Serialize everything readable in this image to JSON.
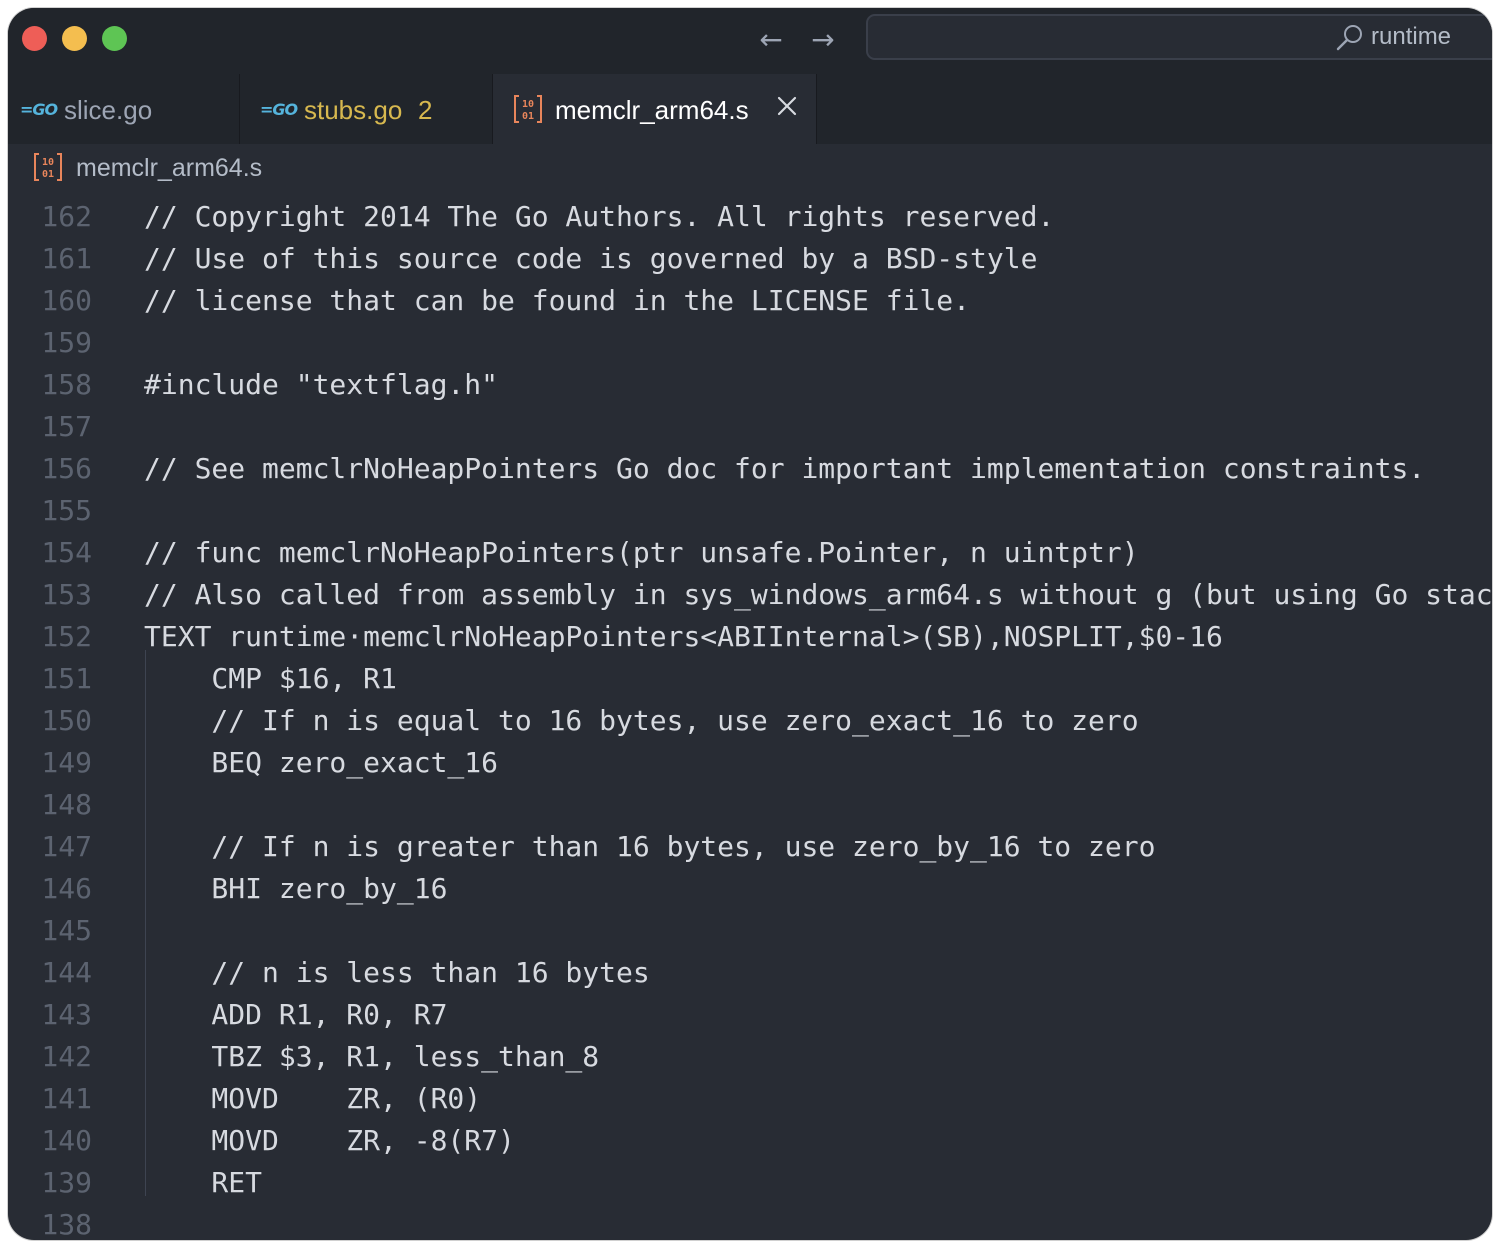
{
  "window": {
    "nav": {
      "back": "←",
      "forward": "→"
    },
    "search": {
      "text": "runtime",
      "icon": "search-icon"
    }
  },
  "tabs": [
    {
      "label": "slice.go",
      "icon": "go-file-icon",
      "icon_text": "=GO",
      "color": "#9da5b4"
    },
    {
      "label": "stubs.go",
      "icon": "go-file-icon",
      "icon_text": "=GO",
      "badge": "2",
      "color": "#d7b84f"
    },
    {
      "label": "memclr_arm64.s",
      "icon": "assembly-file-icon",
      "active": true,
      "close": "×",
      "color": "#ffffff"
    }
  ],
  "breadcrumb": {
    "label": "memclr_arm64.s",
    "icon": "assembly-file-icon"
  },
  "colors": {
    "background": "#282c34",
    "titlebar": "#21252b",
    "line_number": "#5c6370",
    "code_text": "#d7dae0",
    "modified_tab": "#d7b84f",
    "go_icon": "#55b4dc",
    "asm_icon": "#e8855b"
  },
  "editor": {
    "lines": [
      {
        "n": "162",
        "code": "// Copyright 2014 The Go Authors. All rights reserved."
      },
      {
        "n": "161",
        "code": "// Use of this source code is governed by a BSD-style"
      },
      {
        "n": "160",
        "code": "// license that can be found in the LICENSE file."
      },
      {
        "n": "159",
        "code": ""
      },
      {
        "n": "158",
        "code": "#include \"textflag.h\""
      },
      {
        "n": "157",
        "code": ""
      },
      {
        "n": "156",
        "code": "// See memclrNoHeapPointers Go doc for important implementation constraints."
      },
      {
        "n": "155",
        "code": ""
      },
      {
        "n": "154",
        "code": "// func memclrNoHeapPointers(ptr unsafe.Pointer, n uintptr)"
      },
      {
        "n": "153",
        "code": "// Also called from assembly in sys_windows_arm64.s without g (but using Go stac"
      },
      {
        "n": "152",
        "code": "TEXT runtime·memclrNoHeapPointers<ABIInternal>(SB),NOSPLIT,$0-16"
      },
      {
        "n": "151",
        "code": "    CMP $16, R1"
      },
      {
        "n": "150",
        "code": "    // If n is equal to 16 bytes, use zero_exact_16 to zero"
      },
      {
        "n": "149",
        "code": "    BEQ zero_exact_16"
      },
      {
        "n": "148",
        "code": ""
      },
      {
        "n": "147",
        "code": "    // If n is greater than 16 bytes, use zero_by_16 to zero"
      },
      {
        "n": "146",
        "code": "    BHI zero_by_16"
      },
      {
        "n": "145",
        "code": ""
      },
      {
        "n": "144",
        "code": "    // n is less than 16 bytes"
      },
      {
        "n": "143",
        "code": "    ADD R1, R0, R7"
      },
      {
        "n": "142",
        "code": "    TBZ $3, R1, less_than_8"
      },
      {
        "n": "141",
        "code": "    MOVD    ZR, (R0)"
      },
      {
        "n": "140",
        "code": "    MOVD    ZR, -8(R7)"
      },
      {
        "n": "139",
        "code": "    RET"
      },
      {
        "n": "138",
        "code": ""
      }
    ]
  }
}
